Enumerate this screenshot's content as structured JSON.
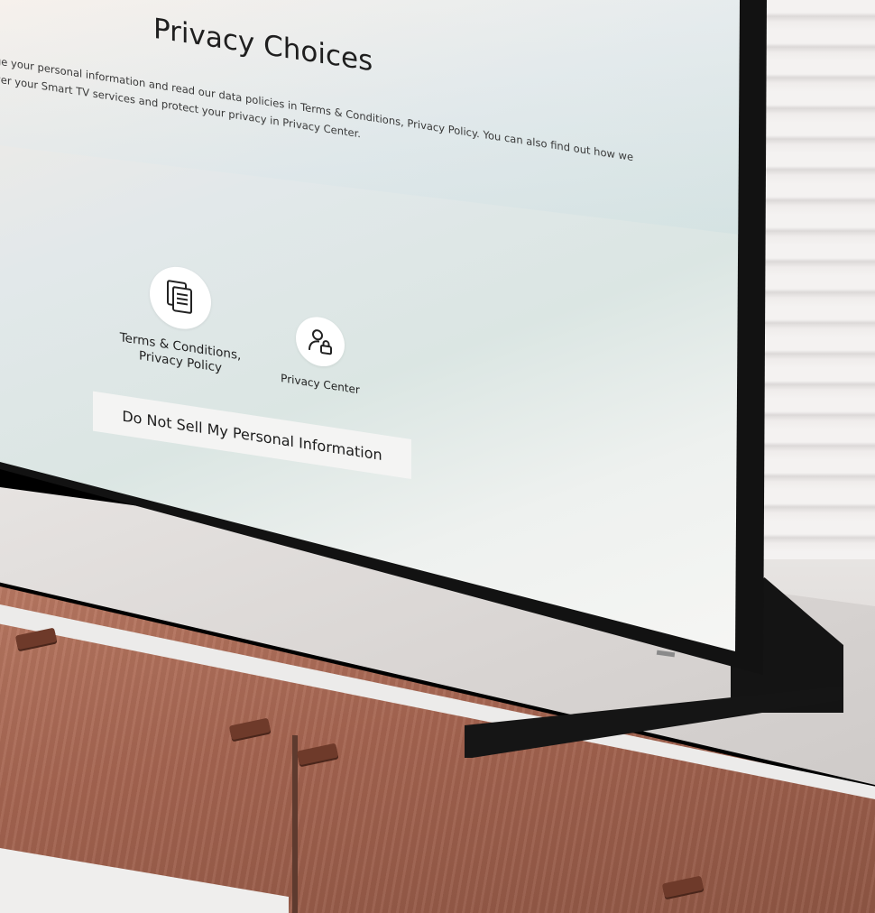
{
  "screen": {
    "title": "Privacy Choices",
    "description_line1": "ge your personal information and read our data policies in Terms & Conditions, Privacy Policy. You can also find out how we",
    "description_line2": "ver your Smart TV services and protect your privacy in Privacy Center.",
    "options": [
      {
        "label_line1": "Terms & Conditions,",
        "label_line2": "Privacy Policy",
        "icon": "document-stack-icon"
      },
      {
        "label": "Privacy Center",
        "icon": "user-lock-icon"
      }
    ],
    "do_not_sell_button": "Do Not Sell My Personal Information"
  },
  "colors": {
    "accent": "#ffffff",
    "text": "#1f1f1f"
  }
}
